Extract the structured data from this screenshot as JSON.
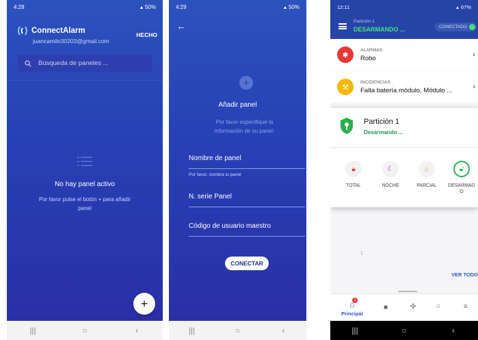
{
  "phone1": {
    "status": {
      "time": "4:28",
      "battery": "50%"
    },
    "app_title": "ConnectAlarm",
    "email": "juancamilo30203@gmail.com",
    "done_label": "HECHO",
    "search_placeholder": "Búsqueda de paneles ...",
    "empty_title": "No hay panel activo",
    "empty_subtitle": "Por favor pulse el botón + para añadir panel",
    "fab_label": "+"
  },
  "phone2": {
    "status": {
      "time": "4:29",
      "battery": "50%"
    },
    "title": "Añadir panel",
    "subtitle": "Por favor especifique la información de su panel:",
    "fields": [
      {
        "label": "Nombre de panel",
        "hint": "Por favor, nombra tu panel"
      },
      {
        "label": "N. serie Panel"
      },
      {
        "label": "Código de usuario maestro"
      }
    ],
    "connect_label": "CONECTAR"
  },
  "phone3": {
    "status": {
      "time": "12:11",
      "battery": "67%"
    },
    "partition_small": "Partición 1",
    "partition_status": "DESARMANDO ...",
    "connected_label": "CONECTADO",
    "alarms": {
      "category": "ALARMAS",
      "value": "Robo"
    },
    "incidents": {
      "category": "INCIDENCIAS",
      "value": "Falta batería módulo, Módulo ..."
    },
    "card": {
      "title": "Partición 1",
      "status": "Desarmando ...",
      "modes": [
        {
          "label": "TOTAL",
          "icon": "lock-icon"
        },
        {
          "label": "NOCHE",
          "icon": "moon-icon"
        },
        {
          "label": "PARCIAL",
          "icon": "home-icon"
        },
        {
          "label": "DESARMADO",
          "icon": "unlock-icon"
        }
      ]
    },
    "ghost_number": "1",
    "see_all_label": "VER TODO",
    "tabs": {
      "main_label": "Principal",
      "badge": "1"
    },
    "colors": {
      "header": "#2644a8",
      "status_green": "#3ee37a",
      "alarm_red": "#e53935",
      "incident_yellow": "#f5b700"
    }
  }
}
